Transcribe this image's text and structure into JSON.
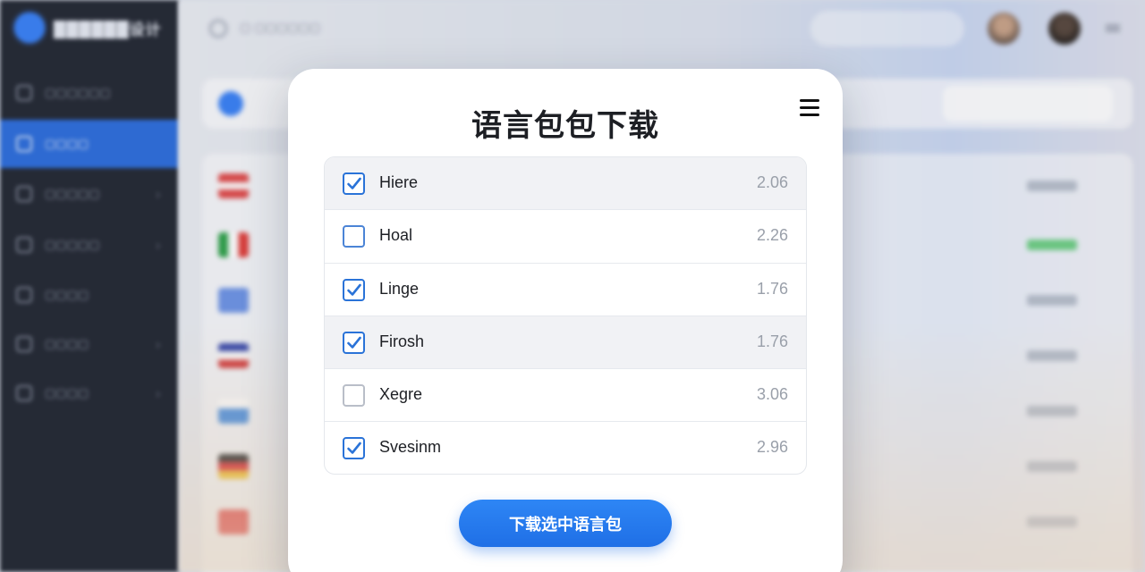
{
  "app": {
    "logo_text": "██████设计",
    "breadcrumb": "▢ ▢▢▢▢▢▢"
  },
  "sidebar": {
    "items": [
      {
        "label": "▢▢▢▢▢▢",
        "icon": "dashboard-icon",
        "active": false,
        "chevron": false
      },
      {
        "label": "▢▢▢▢",
        "icon": "language-icon",
        "active": true,
        "chevron": false
      },
      {
        "label": "▢▢▢▢▢",
        "icon": "users-icon",
        "active": false,
        "chevron": true
      },
      {
        "label": "▢▢▢▢▢",
        "icon": "folder-icon",
        "active": false,
        "chevron": true
      },
      {
        "label": "▢▢▢▢",
        "icon": "chat-icon",
        "active": false,
        "chevron": false
      },
      {
        "label": "▢▢▢▢",
        "icon": "calendar-icon",
        "active": false,
        "chevron": true
      },
      {
        "label": "▢▢▢▢",
        "icon": "globe-icon",
        "active": false,
        "chevron": true
      }
    ]
  },
  "modal": {
    "title": "语言包包下载",
    "menu_icon": "hamburger-menu-icon",
    "download_button": "下载选中语言包",
    "languages": [
      {
        "name": "Hiere",
        "size": "2.06",
        "checked": true,
        "shaded": true
      },
      {
        "name": "Hoal",
        "size": "2.26",
        "checked": false,
        "shaded": false,
        "outline": "blue"
      },
      {
        "name": "Linge",
        "size": "1.76",
        "checked": true,
        "shaded": false
      },
      {
        "name": "Firosh",
        "size": "1.76",
        "checked": true,
        "shaded": true
      },
      {
        "name": "Xegre",
        "size": "3.06",
        "checked": false,
        "shaded": false,
        "outline": "gray"
      },
      {
        "name": "Svesinm",
        "size": "2.96",
        "checked": true,
        "shaded": false
      }
    ]
  },
  "colors": {
    "accent": "#1f6fe6",
    "sidebar_bg": "#262b36",
    "sidebar_active": "#2f6fdc",
    "check_blue": "#2a73d8"
  }
}
